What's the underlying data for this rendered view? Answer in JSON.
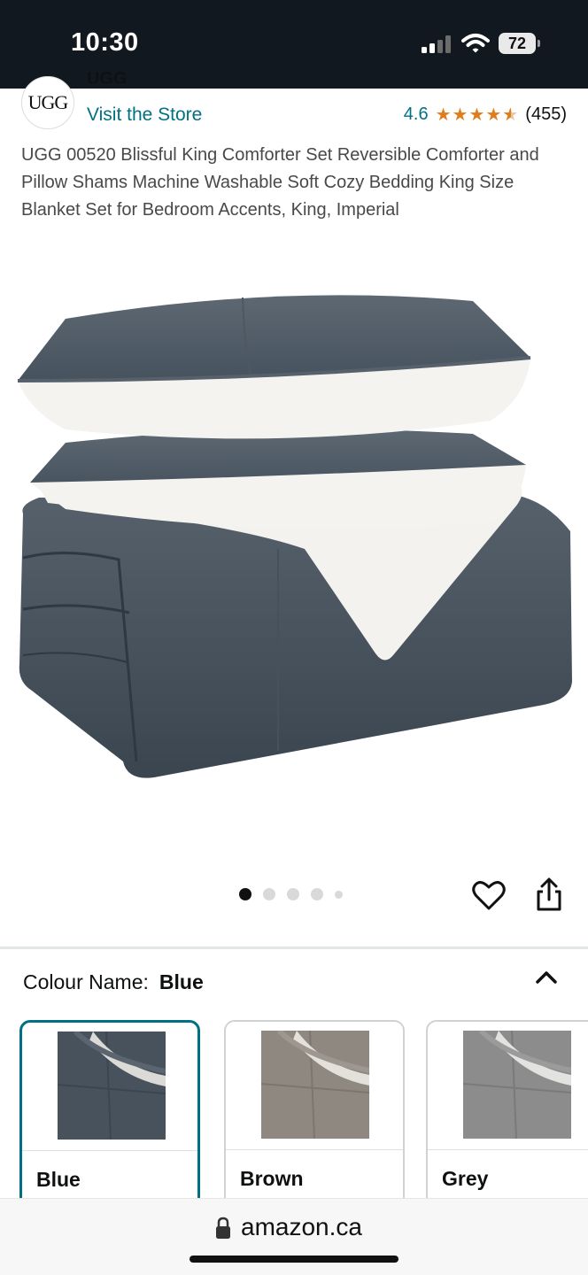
{
  "status_bar": {
    "time": "10:30",
    "battery": "72",
    "icons": [
      "cellular-signal-icon",
      "wifi-icon",
      "battery-icon"
    ]
  },
  "store": {
    "logo_text": "UGG",
    "brand": "UGG",
    "visit_link": "Visit the Store"
  },
  "rating": {
    "value": "4.6",
    "stars": 4.6,
    "count": "(455)"
  },
  "product": {
    "title": "UGG 00520 Blissful King Comforter Set Reversible Comforter and Pillow Shams Machine Washable Soft Cozy Bedding King Size Blanket Set for Bedroom Accents, King, Imperial",
    "image_count": 5,
    "current_image": 1
  },
  "actions": {
    "wishlist_icon": "heart-icon",
    "share_icon": "share-icon"
  },
  "variation": {
    "label": "Colour Name:",
    "selected": "Blue",
    "options": [
      {
        "name": "Blue",
        "color": "#4a5560",
        "selected": true
      },
      {
        "name": "Brown",
        "color": "#8f8880",
        "selected": false
      },
      {
        "name": "Grey",
        "color": "#8c8c8c",
        "selected": false
      }
    ]
  },
  "browser": {
    "url": "amazon.ca"
  },
  "colors": {
    "link": "#007185",
    "star": "#e07c1a",
    "status_bar_bg": "#111820"
  }
}
